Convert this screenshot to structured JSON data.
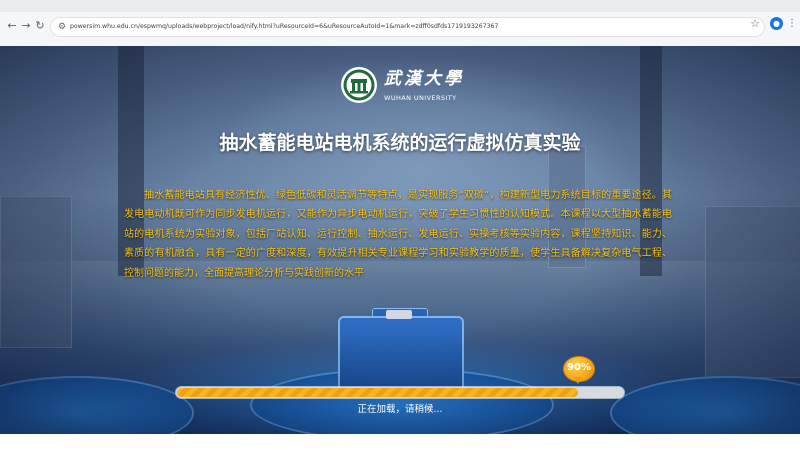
{
  "browser": {
    "url": "powersim.whu.edu.cn/espwmq/uploads/webproject/load/nify.html?uResourceId=6&uResourceAutoId=1&mark=zdff0sdfds1719193267367",
    "profile_initial": "●"
  },
  "logo": {
    "name_cn": "武漢大學",
    "name_en": "WUHAN UNIVERSITY"
  },
  "page": {
    "title": "抽水蓄能电站电机系统的运行虚拟仿真实验",
    "description": "抽水蓄能电站具有经济性优、绿色低碳和灵活调节等特点，是实现服务“双碳”，构建新型电力系统目标的重要途径。其发电电动机既可作为同步发电机运行，又能作为异步电动机运行，突破了学生习惯性的认知模式。本课程以大型抽水蓄能电站的电机系统为实验对象，包括厂站认知、运行控制、抽水运行、发电运行、实操考核等实验内容，课程坚持知识、能力、素质的有机融合，具有一定的广度和深度，有效提升相关专业课程学习和实验教学的质量，使学生具备解决复杂电气工程、控制问题的能力，全面提高理论分析与实践创新的水平"
  },
  "loading": {
    "progress": 0.9,
    "percent_label": "90%",
    "status_text": "正在加载，请稍候..."
  },
  "colors": {
    "accent_text": "#f6c21c",
    "progress_fill": "#f7b51f",
    "hall_blue": "#1d63b6"
  }
}
